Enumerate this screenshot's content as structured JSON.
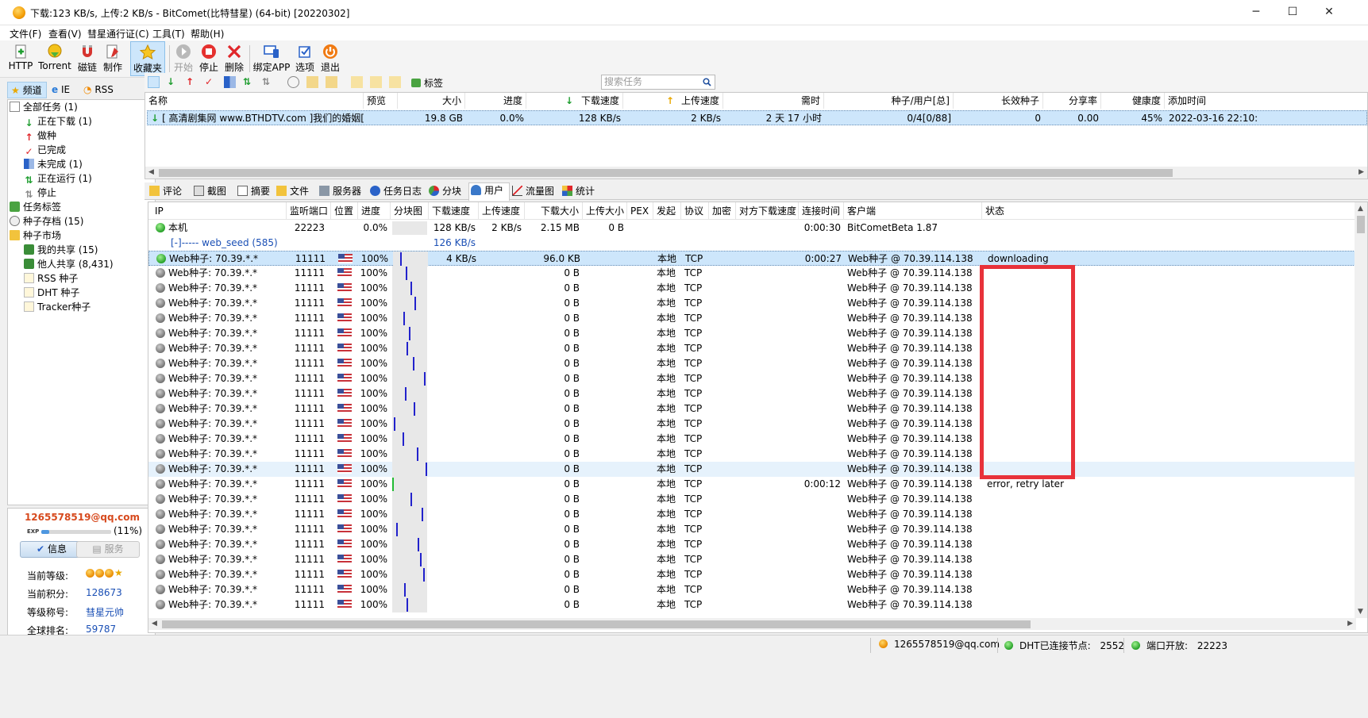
{
  "window": {
    "title": "下载:123 KB/s, 上传:2 KB/s - BitComet(比特彗星) (64-bit) [20220302]",
    "controls": [
      "─",
      "☐",
      "✕"
    ]
  },
  "menu": [
    "文件(F)",
    "查看(V)",
    "彗星通行证(C)",
    "工具(T)",
    "帮助(H)"
  ],
  "toolbar": [
    {
      "label": "HTTP",
      "icon": "http-plus-icon"
    },
    {
      "label": "Torrent",
      "icon": "torrent-icon"
    },
    {
      "label": "磁链",
      "icon": "magnet-icon"
    },
    {
      "label": "制作",
      "icon": "make-torrent-icon"
    },
    {
      "label": "收藏夹",
      "icon": "favorites-star-icon",
      "active": true
    },
    {
      "label": "开始",
      "icon": "start-icon",
      "disabled": true
    },
    {
      "label": "停止",
      "icon": "stop-icon"
    },
    {
      "label": "删除",
      "icon": "delete-icon"
    },
    {
      "label": "绑定APP",
      "icon": "bind-app-icon"
    },
    {
      "label": "选项",
      "icon": "options-icon"
    },
    {
      "label": "退出",
      "icon": "exit-icon"
    }
  ],
  "sidebar": {
    "tabs": [
      "频道",
      "IE",
      "RSS"
    ],
    "items": [
      {
        "label": "全部任务 (1)"
      },
      {
        "label": "正在下载 (1)"
      },
      {
        "label": "做种"
      },
      {
        "label": "已完成"
      },
      {
        "label": "未完成 (1)"
      },
      {
        "label": "正在运行 (1)"
      },
      {
        "label": "停止"
      },
      {
        "label": "任务标签"
      },
      {
        "label": "种子存档 (15)"
      },
      {
        "label": "种子市场"
      },
      {
        "label": "我的共享 (15)"
      },
      {
        "label": "他人共享 (8,431)"
      },
      {
        "label": "RSS 种子"
      },
      {
        "label": "DHT 种子"
      },
      {
        "label": "Tracker种子"
      }
    ]
  },
  "user": {
    "email": "1265578519@qq.com",
    "exp_label": "EXP",
    "exp_percent_text": "(11%)",
    "exp_fraction": 0.11,
    "info_button": "信息",
    "service_button": "服务",
    "level_label": "当前等级:",
    "points_label": "当前积分:",
    "points": "128673",
    "title_label": "等级称号:",
    "title": "彗星元帅",
    "rank_label": "全球排名:",
    "rank": "59787"
  },
  "taskbar": {
    "tag_label": "标签",
    "search_placeholder": "搜索任务"
  },
  "tasklist": {
    "columns": [
      "名称",
      "预览",
      "大小",
      "进度",
      "下载速度",
      "上传速度",
      "需时",
      "种子/用户[总]",
      "长效种子",
      "分享率",
      "健康度",
      "添加时间"
    ],
    "rows": [
      {
        "name": "[ 高清剧集网 www.BTHDTV.com ]我们的婚姻[全...",
        "preview": "",
        "size": "19.8 GB",
        "progress": "0.0%",
        "download": "128 KB/s",
        "upload": "2 KB/s",
        "eta": "2 天 17 小时",
        "seeds": "0/4[0/88]",
        "long_seeds": "0",
        "ratio": "0.00",
        "health": "45%",
        "added": "2022-03-16 22:10:"
      }
    ]
  },
  "detail_tabs": [
    "评论",
    "截图",
    "摘要",
    "文件",
    "服务器",
    "任务日志",
    "分块",
    "用户",
    "流量图",
    "统计"
  ],
  "peers": {
    "columns": [
      "IP",
      "监听端口",
      "位置",
      "进度",
      "分块图",
      "下载速度",
      "上传速度",
      "下载大小",
      "上传大小",
      "PEX",
      "发起",
      "协议",
      "加密",
      "对方下载速度",
      "连接时间",
      "客户端",
      "状态"
    ],
    "local": {
      "ip": "本机",
      "port": "22223",
      "progress": "0.0%",
      "down": "128 KB/s",
      "up": "2 KB/s",
      "down_size": "2.15 MB",
      "up_size": "0 B",
      "time": "0:00:30",
      "client": "BitCometBeta 1.87"
    },
    "web_seed": {
      "label": "[-]----- web_seed (585)",
      "down": "126 KB/s"
    },
    "rows": [
      {
        "ip": "Web种子: 70.39.*.*",
        "port": "11111",
        "progress": "100%",
        "down": "4 KB/s",
        "down_size": "96.0 KB",
        "initiator": "本地",
        "protocol": "TCP",
        "time": "0:00:27",
        "client": "Web种子 @ 70.39.114.138",
        "status": "downloading"
      },
      {
        "ip": "Web种子: 70.39.*.*",
        "port": "11111",
        "progress": "100%",
        "down": "",
        "down_size": "0 B",
        "initiator": "本地",
        "protocol": "TCP",
        "time": "",
        "client": "Web种子 @ 70.39.114.138",
        "status": ""
      },
      {
        "ip": "Web种子: 70.39.*.*",
        "port": "11111",
        "progress": "100%",
        "down": "",
        "down_size": "0 B",
        "initiator": "本地",
        "protocol": "TCP",
        "time": "",
        "client": "Web种子 @ 70.39.114.138",
        "status": ""
      },
      {
        "ip": "Web种子: 70.39.*.*",
        "port": "11111",
        "progress": "100%",
        "down": "",
        "down_size": "0 B",
        "initiator": "本地",
        "protocol": "TCP",
        "time": "",
        "client": "Web种子 @ 70.39.114.138",
        "status": ""
      },
      {
        "ip": "Web种子: 70.39.*.*",
        "port": "11111",
        "progress": "100%",
        "down": "",
        "down_size": "0 B",
        "initiator": "本地",
        "protocol": "TCP",
        "time": "",
        "client": "Web种子 @ 70.39.114.138",
        "status": ""
      },
      {
        "ip": "Web种子: 70.39.*.*",
        "port": "11111",
        "progress": "100%",
        "down": "",
        "down_size": "0 B",
        "initiator": "本地",
        "protocol": "TCP",
        "time": "",
        "client": "Web种子 @ 70.39.114.138",
        "status": ""
      },
      {
        "ip": "Web种子: 70.39.*.*",
        "port": "11111",
        "progress": "100%",
        "down": "",
        "down_size": "0 B",
        "initiator": "本地",
        "protocol": "TCP",
        "time": "",
        "client": "Web种子 @ 70.39.114.138",
        "status": ""
      },
      {
        "ip": "Web种子: 70.39.*.*",
        "port": "11111",
        "progress": "100%",
        "down": "",
        "down_size": "0 B",
        "initiator": "本地",
        "protocol": "TCP",
        "time": "",
        "client": "Web种子 @ 70.39.114.138",
        "status": ""
      },
      {
        "ip": "Web种子: 70.39.*.*",
        "port": "11111",
        "progress": "100%",
        "down": "",
        "down_size": "0 B",
        "initiator": "本地",
        "protocol": "TCP",
        "time": "",
        "client": "Web种子 @ 70.39.114.138",
        "status": ""
      },
      {
        "ip": "Web种子: 70.39.*.*",
        "port": "11111",
        "progress": "100%",
        "down": "",
        "down_size": "0 B",
        "initiator": "本地",
        "protocol": "TCP",
        "time": "",
        "client": "Web种子 @ 70.39.114.138",
        "status": ""
      },
      {
        "ip": "Web种子: 70.39.*.*",
        "port": "11111",
        "progress": "100%",
        "down": "",
        "down_size": "0 B",
        "initiator": "本地",
        "protocol": "TCP",
        "time": "",
        "client": "Web种子 @ 70.39.114.138",
        "status": ""
      },
      {
        "ip": "Web种子: 70.39.*.*",
        "port": "11111",
        "progress": "100%",
        "down": "",
        "down_size": "0 B",
        "initiator": "本地",
        "protocol": "TCP",
        "time": "",
        "client": "Web种子 @ 70.39.114.138",
        "status": ""
      },
      {
        "ip": "Web种子: 70.39.*.*",
        "port": "11111",
        "progress": "100%",
        "down": "",
        "down_size": "0 B",
        "initiator": "本地",
        "protocol": "TCP",
        "time": "",
        "client": "Web种子 @ 70.39.114.138",
        "status": ""
      },
      {
        "ip": "Web种子: 70.39.*.*",
        "port": "11111",
        "progress": "100%",
        "down": "",
        "down_size": "0 B",
        "initiator": "本地",
        "protocol": "TCP",
        "time": "",
        "client": "Web种子 @ 70.39.114.138",
        "status": ""
      },
      {
        "ip": "Web种子: 70.39.*.*",
        "port": "11111",
        "progress": "100%",
        "down": "",
        "down_size": "0 B",
        "initiator": "本地",
        "protocol": "TCP",
        "time": "",
        "client": "Web种子 @ 70.39.114.138",
        "status": ""
      },
      {
        "ip": "Web种子: 70.39.*.*",
        "port": "11111",
        "progress": "100%",
        "down": "",
        "down_size": "0 B",
        "initiator": "本地",
        "protocol": "TCP",
        "time": "0:00:12",
        "client": "Web种子 @ 70.39.114.138",
        "status": "error, retry later"
      },
      {
        "ip": "Web种子: 70.39.*.*",
        "port": "11111",
        "progress": "100%",
        "down": "",
        "down_size": "0 B",
        "initiator": "本地",
        "protocol": "TCP",
        "time": "",
        "client": "Web种子 @ 70.39.114.138",
        "status": ""
      },
      {
        "ip": "Web种子: 70.39.*.*",
        "port": "11111",
        "progress": "100%",
        "down": "",
        "down_size": "0 B",
        "initiator": "本地",
        "protocol": "TCP",
        "time": "",
        "client": "Web种子 @ 70.39.114.138",
        "status": ""
      },
      {
        "ip": "Web种子: 70.39.*.*",
        "port": "11111",
        "progress": "100%",
        "down": "",
        "down_size": "0 B",
        "initiator": "本地",
        "protocol": "TCP",
        "time": "",
        "client": "Web种子 @ 70.39.114.138",
        "status": ""
      },
      {
        "ip": "Web种子: 70.39.*.*",
        "port": "11111",
        "progress": "100%",
        "down": "",
        "down_size": "0 B",
        "initiator": "本地",
        "protocol": "TCP",
        "time": "",
        "client": "Web种子 @ 70.39.114.138",
        "status": ""
      },
      {
        "ip": "Web种子: 70.39.*.*",
        "port": "11111",
        "progress": "100%",
        "down": "",
        "down_size": "0 B",
        "initiator": "本地",
        "protocol": "TCP",
        "time": "",
        "client": "Web种子 @ 70.39.114.138",
        "status": ""
      },
      {
        "ip": "Web种子: 70.39.*.*",
        "port": "11111",
        "progress": "100%",
        "down": "",
        "down_size": "0 B",
        "initiator": "本地",
        "protocol": "TCP",
        "time": "",
        "client": "Web种子 @ 70.39.114.138",
        "status": ""
      },
      {
        "ip": "Web种子: 70.39.*.*",
        "port": "11111",
        "progress": "100%",
        "down": "",
        "down_size": "0 B",
        "initiator": "本地",
        "protocol": "TCP",
        "time": "",
        "client": "Web种子 @ 70.39.114.138",
        "status": ""
      },
      {
        "ip": "Web种子: 70.39.*.*",
        "port": "11111",
        "progress": "100%",
        "down": "",
        "down_size": "0 B",
        "initiator": "本地",
        "protocol": "TCP",
        "time": "",
        "client": "Web种子 @ 70.39.114.138",
        "status": ""
      }
    ]
  },
  "statusbar": {
    "email": "1265578519@qq.com",
    "dht_label": "DHT已连接节点:",
    "dht_nodes": "2552",
    "port_label": "端口开放:",
    "port": "22223"
  },
  "colors": {
    "selection": "#cde6fb",
    "highlight_box": "#e8323a",
    "email": "#d74a1e",
    "link_value": "#1a4fb5"
  }
}
